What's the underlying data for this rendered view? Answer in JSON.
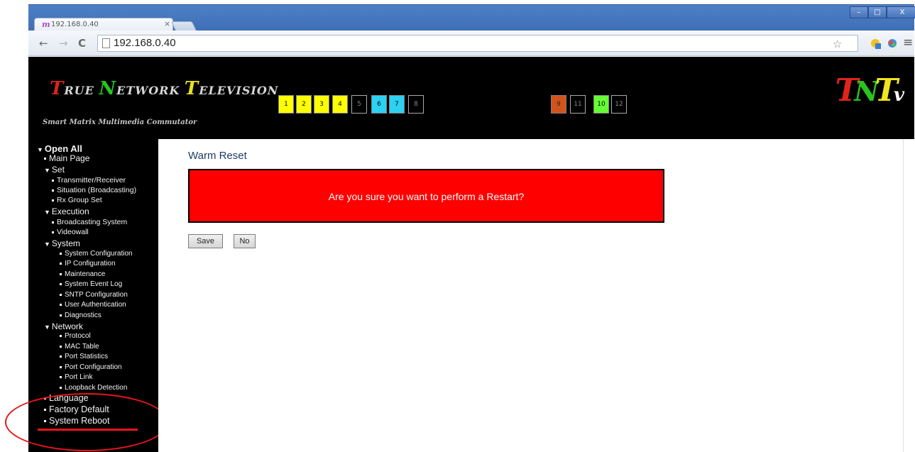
{
  "browser": {
    "tab_title": "192.168.0.40",
    "tab_favicon": "m",
    "tab_close": "×",
    "url": "192.168.0.40",
    "back_icon": "←",
    "forward_icon": "→",
    "reload_icon": "C",
    "star_icon": "☆",
    "menu_icon": "≡",
    "win_min": "–",
    "win_max": "□",
    "win_close": "X"
  },
  "header": {
    "brand_true_cap": "T",
    "brand_true_rest": "RUE ",
    "brand_network_cap": "N",
    "brand_network_rest": "ETWORK ",
    "brand_tv_cap": "T",
    "brand_tv_rest": "ELEVISION",
    "tagline": "Smart Matrix Multimedia Commutator",
    "logo_t1": "T",
    "logo_n": "N",
    "logo_t2": "T",
    "logo_v": "v",
    "ports": [
      {
        "label": "1",
        "color": "yellow"
      },
      {
        "label": "2",
        "color": "yellow"
      },
      {
        "label": "3",
        "color": "yellow"
      },
      {
        "label": "4",
        "color": "yellow"
      },
      {
        "label": "5",
        "color": "black"
      },
      {
        "label": "6",
        "color": "cyan"
      },
      {
        "label": "7",
        "color": "cyan"
      },
      {
        "label": "8",
        "color": "black"
      },
      {
        "label": "9",
        "color": "orange"
      },
      {
        "label": "11",
        "color": "black"
      },
      {
        "label": "10",
        "color": "green"
      },
      {
        "label": "12",
        "color": "black"
      }
    ]
  },
  "sidebar": {
    "open_all": "Open All",
    "main_page": "Main Page",
    "set": "Set",
    "transmitter_receiver": "Transmitter/Receiver",
    "situation": "Situation (Broadcasting)",
    "rx_group_set": "Rx Group Set",
    "execution": "Execution",
    "broadcasting_system": "Broadcasting System",
    "videowall": "Videowall",
    "system": "System",
    "system_configuration": "System Configuration",
    "ip_configuration": "IP Configuration",
    "maintenance": "Maintenance",
    "system_event_log": "System Event Log",
    "sntp_configuration": "SNTP Configuration",
    "user_authentication": "User Authentication",
    "diagnostics": "Diagnostics",
    "network": "Network",
    "protocol": "Protocol",
    "mac_table": "MAC Table",
    "port_statistics": "Port Statistics",
    "port_configuration": "Port Configuration",
    "port_link": "Port Link",
    "loopback_detection": "Loopback Detection",
    "language": "Language",
    "factory_default": "Factory Default",
    "system_reboot": "System Reboot"
  },
  "main": {
    "title": "Warm Reset",
    "warning": "Are you sure you want to perform a Restart?",
    "save_label": "Save",
    "no_label": "No"
  },
  "colors": {
    "warning_bg": "#ff0000",
    "annotation": "#e8141a",
    "header_bg": "#000000"
  }
}
